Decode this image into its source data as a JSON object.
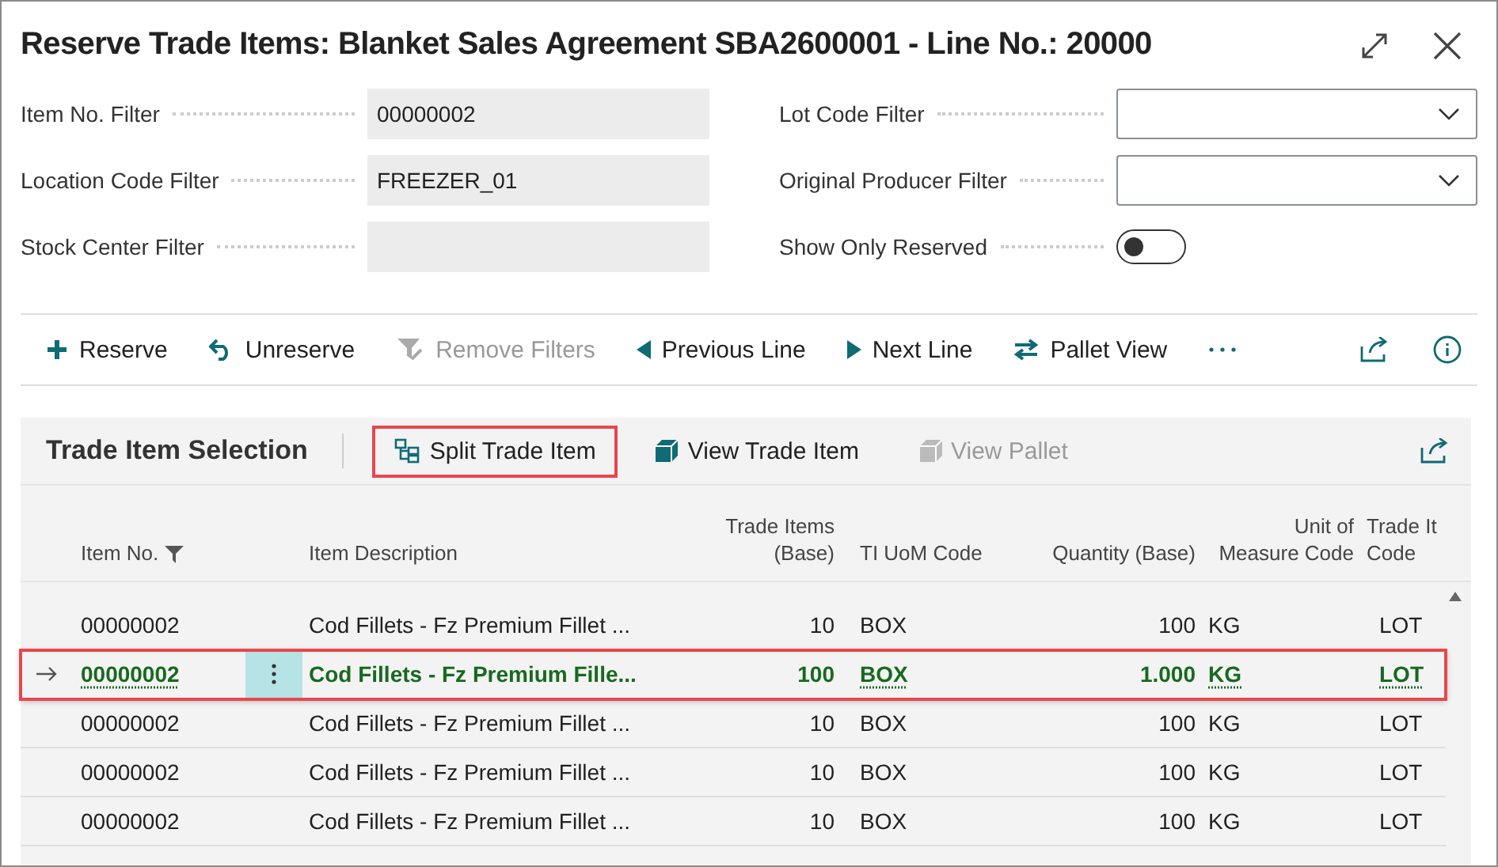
{
  "window": {
    "title": "Reserve Trade Items: Blanket Sales Agreement SBA2600001 - Line No.: 20000"
  },
  "filters_left": [
    {
      "label": "Item No. Filter",
      "value": "00000002"
    },
    {
      "label": "Location Code Filter",
      "value": "FREEZER_01"
    },
    {
      "label": "Stock Center Filter"
    }
  ],
  "filters_right": [
    {
      "kind": "dropdown",
      "label": "Lot Code Filter"
    },
    {
      "kind": "dropdown",
      "label": "Original Producer Filter"
    },
    {
      "kind": "toggle",
      "label": "Show Only Reserved",
      "on": false
    }
  ],
  "toolbar": [
    {
      "label": "Reserve",
      "disabled": false
    },
    {
      "label": "Unreserve",
      "disabled": false
    },
    {
      "label": "Remove Filters",
      "disabled": true
    },
    {
      "label": "Previous Line",
      "disabled": false
    },
    {
      "label": "Next Line",
      "disabled": false
    },
    {
      "label": "Pallet View",
      "disabled": false
    }
  ],
  "subpanel": {
    "title": "Trade Item Selection",
    "actions": [
      {
        "label": "Split Trade Item",
        "disabled": false,
        "highlighted": true
      },
      {
        "label": "View Trade Item",
        "disabled": false,
        "highlighted": false
      },
      {
        "label": "View Pallet",
        "disabled": true,
        "highlighted": false
      }
    ]
  },
  "table": {
    "columns": [
      {
        "label": "Item No.",
        "filter": true
      },
      {
        "label": "Item Description",
        "filter": false
      },
      {
        "label": "Trade Items\n(Base)",
        "filter": false
      },
      {
        "label": "TI UoM Code",
        "filter": false
      },
      {
        "label": "Quantity (Base)",
        "filter": false
      },
      {
        "label": "Unit of\nMeasure Code",
        "filter": false
      },
      {
        "label": "Trade It\nCode",
        "filter": false
      }
    ],
    "rows": [
      {
        "selected": false,
        "highlighted": false,
        "cells": [
          "00000002",
          "Cod Fillets - Fz Premium Fillet ...",
          "10",
          "BOX",
          "100",
          "KG",
          "LOT"
        ]
      },
      {
        "selected": true,
        "highlighted": true,
        "cells": [
          "00000002",
          "Cod Fillets - Fz Premium Fille...",
          "100",
          "BOX",
          "1.000",
          "KG",
          "LOT"
        ]
      },
      {
        "selected": false,
        "highlighted": false,
        "cells": [
          "00000002",
          "Cod Fillets - Fz Premium Fillet ...",
          "10",
          "BOX",
          "100",
          "KG",
          "LOT"
        ]
      },
      {
        "selected": false,
        "highlighted": false,
        "cells": [
          "00000002",
          "Cod Fillets - Fz Premium Fillet ...",
          "10",
          "BOX",
          "100",
          "KG",
          "LOT"
        ]
      },
      {
        "selected": false,
        "highlighted": false,
        "cells": [
          "00000002",
          "Cod Fillets - Fz Premium Fillet ...",
          "10",
          "BOX",
          "100",
          "KG",
          "LOT"
        ]
      }
    ]
  }
}
